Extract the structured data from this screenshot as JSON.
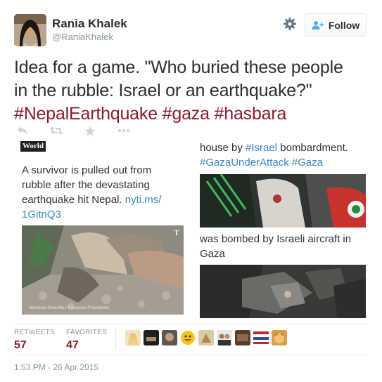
{
  "author": {
    "name": "Rania Khalek",
    "handle": "@RaniaKhalek"
  },
  "follow_button": {
    "label": "Follow"
  },
  "tweet": {
    "text_line1": "Idea for a game. \"Who buried these people",
    "text_line2": "in the rubble: Israel or an earthquake?\"",
    "hashtags": [
      "#NepalEarthquake",
      "#gaza",
      "#hasbara"
    ]
  },
  "actions": [
    "reply-icon",
    "retweet-icon",
    "favorite-icon",
    "more-icon"
  ],
  "image_left": {
    "badge": "World",
    "caption_line1": "A survivor is pulled out from",
    "caption_line2": "rubble after the devastating",
    "caption_line3_text": "earthquake hit Nepal. ",
    "caption_line3_link": "nyti.ms/",
    "caption_line4_link": "1GitnQ3",
    "photo_credit": "Narendra Shrestha / European Pressphoto"
  },
  "image_right": {
    "line1_text_a": "house by ",
    "line1_link": "#Israel",
    "line1_text_b": " bombardment.",
    "line2_link1": "#GazaUnderAttack",
    "line2_link2": "#Gaza",
    "line3": "was bombed by Israeli aircraft in",
    "line4": "Gaza"
  },
  "stats": {
    "retweets_label": "RETWEETS",
    "retweets_value": "57",
    "favorites_label": "FAVORITES",
    "favorites_value": "47"
  },
  "favoriters_count": 10,
  "timestamp": "1:53 PM - 26 Apr 2015",
  "colors": {
    "hashtag": "#8a1c2e",
    "link": "#3b88c3",
    "muted": "#8899a6",
    "text": "#292f33"
  }
}
